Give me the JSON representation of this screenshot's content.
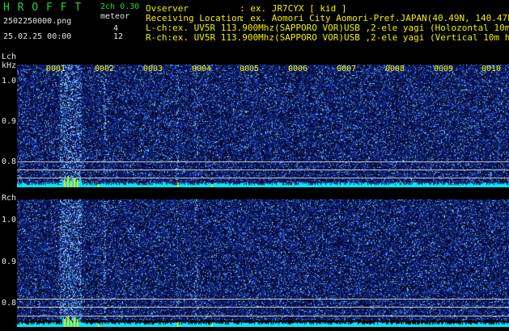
{
  "header": {
    "app_logo": "H R O F F T",
    "version": "2ch 0.30",
    "filename": "2502250000.png",
    "meteor_label": "meteor",
    "datetime": "25.02.25 00:00",
    "count_lch": "4",
    "count_rch": "12",
    "observer_label": "Ovserver",
    "observer_value": ": ex. JR7CYX [ kid ]",
    "location_label": "Receiving Location",
    "location_value": ": ex. Aomori City Aomori-Pref.JAPAN(40.49N, 140.47E)",
    "lch_line": "L-ch:ex. UV5R 113.900Mhz(SAPPORO VOR)USB ,2-ele yagi (Holozontal 10m height)",
    "rch_line": "R-ch:ex. UV5R 113.900Mhz(SAPPORO VOR)USB ,2-ele yagi (Vertical 10m height)"
  },
  "lch_panel": {
    "channel_label": "Lch",
    "unit_label": "kHz",
    "y_ticks": [
      "1.0",
      "0.9",
      "0.8"
    ],
    "time_ticks": [
      "0001",
      "0002",
      "0003",
      "0004",
      "0005",
      "0006",
      "0007",
      "0008",
      "0009",
      "0010"
    ]
  },
  "rch_panel": {
    "channel_label": "Rch",
    "y_ticks": [
      "1.0",
      "0.9",
      "0.8"
    ]
  },
  "colors": {
    "logo_green": "#22d33a",
    "label_yellow": "#f2f200",
    "text_white": "#e6e6e6",
    "spectrum_blue": "#1a3fb0",
    "spectrum_bright": "#8fd8ff",
    "level_cyan": "#00e8ff",
    "meteor_yellow": "#f0e000"
  }
}
